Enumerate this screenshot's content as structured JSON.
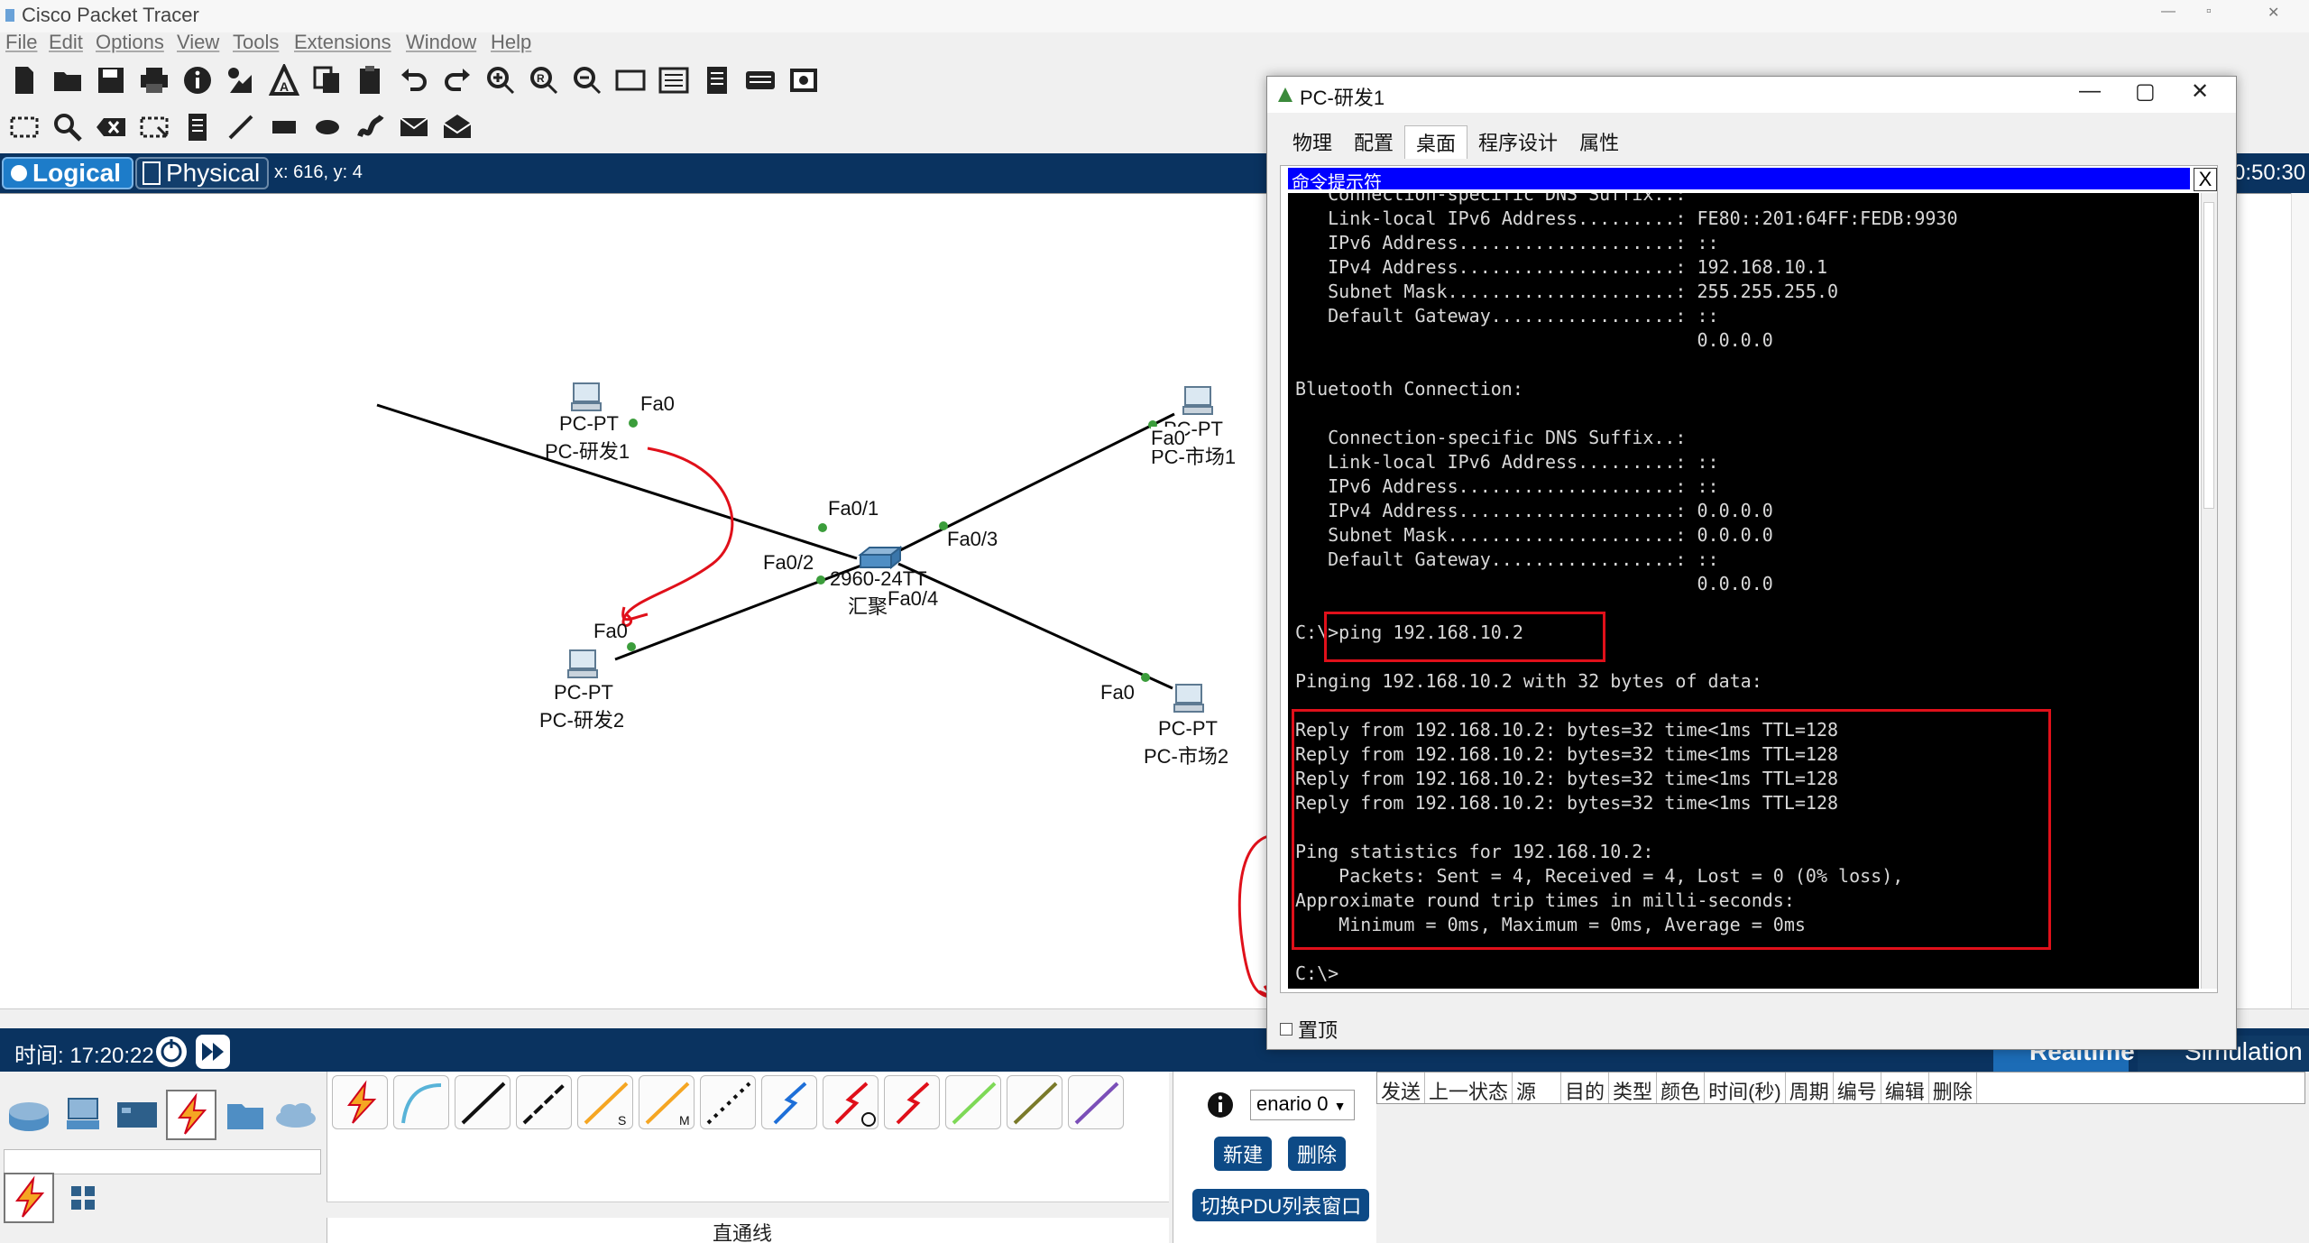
{
  "app": {
    "title": "Cisco Packet Tracer",
    "window_controls": [
      "—",
      "▫",
      "✕"
    ]
  },
  "menu": [
    "File",
    "Edit",
    "Options",
    "View",
    "Tools",
    "Extensions",
    "Window",
    "Help"
  ],
  "modebar": {
    "logical": "Logical",
    "physical": "Physical",
    "coords": "x: 616, y: 4",
    "clock": "0:50:30"
  },
  "topology": {
    "devices": [
      {
        "type": "PC-PT",
        "name": "PC-研发1"
      },
      {
        "type": "PC-PT",
        "name": "PC-研发2"
      },
      {
        "type": "PC-PT",
        "name": "PC-市场1"
      },
      {
        "type": "PC-PT",
        "name": "PC-市场2"
      },
      {
        "type": "2960-24TT",
        "name": "汇聚"
      }
    ],
    "ports": {
      "pc1": "Fa0",
      "pc2": "Fa0",
      "pc3": "Fa0",
      "pc4": "Fa0",
      "sw1": "Fa0/1",
      "sw2": "Fa0/2",
      "sw3": "Fa0/3",
      "sw4": "Fa0/4"
    },
    "switch_model": "2960-24TT",
    "switch_name": "汇聚"
  },
  "timebar": {
    "time": "时间: 17:20:22",
    "realtime": "Realtime",
    "simulation": "Simulation"
  },
  "bottom": {
    "cable_label": "直通线",
    "scenario": "enario 0",
    "new_btn": "新建",
    "delete_btn": "删除",
    "toggle_pdu": "切换PDU列表窗口",
    "pdu_columns": [
      "发送",
      "上一状态",
      "源",
      "目的",
      "类型",
      "颜色",
      "时间(秒)",
      "周期",
      "编号",
      "编辑",
      "删除"
    ]
  },
  "pcwindow": {
    "title": "PC-研发1",
    "controls": [
      "—",
      "▢",
      "✕"
    ],
    "tabs": [
      "物理",
      "配置",
      "桌面",
      "程序设计",
      "属性"
    ],
    "active_tab": "桌面",
    "cmd_title": "命令提示符",
    "cmd_close": "X",
    "stay_on_top": "置顶",
    "terminal_lines": [
      "   Connection-specific DNS Suffix..:",
      "   Link-local IPv6 Address.........: FE80::201:64FF:FEDB:9930",
      "   IPv6 Address....................: ::",
      "   IPv4 Address....................: 192.168.10.1",
      "   Subnet Mask.....................: 255.255.255.0",
      "   Default Gateway.................: ::",
      "                                     0.0.0.0",
      "",
      "Bluetooth Connection:",
      "",
      "   Connection-specific DNS Suffix..:",
      "   Link-local IPv6 Address.........: ::",
      "   IPv6 Address....................: ::",
      "   IPv4 Address....................: 0.0.0.0",
      "   Subnet Mask.....................: 0.0.0.0",
      "   Default Gateway.................: ::",
      "                                     0.0.0.0",
      "",
      "C:\\>ping 192.168.10.2",
      "",
      "Pinging 192.168.10.2 with 32 bytes of data:",
      "",
      "Reply from 192.168.10.2: bytes=32 time<1ms TTL=128",
      "Reply from 192.168.10.2: bytes=32 time<1ms TTL=128",
      "Reply from 192.168.10.2: bytes=32 time<1ms TTL=128",
      "Reply from 192.168.10.2: bytes=32 time<1ms TTL=128",
      "",
      "Ping statistics for 192.168.10.2:",
      "    Packets: Sent = 4, Received = 4, Lost = 0 (0% loss),",
      "Approximate round trip times in milli-seconds:",
      "    Minimum = 0ms, Maximum = 0ms, Average = 0ms",
      "",
      "C:\\>"
    ]
  },
  "colors": {
    "navy": "#0a3360",
    "annotation_red": "#e0101a",
    "cmd_blue": "#0000ff"
  }
}
